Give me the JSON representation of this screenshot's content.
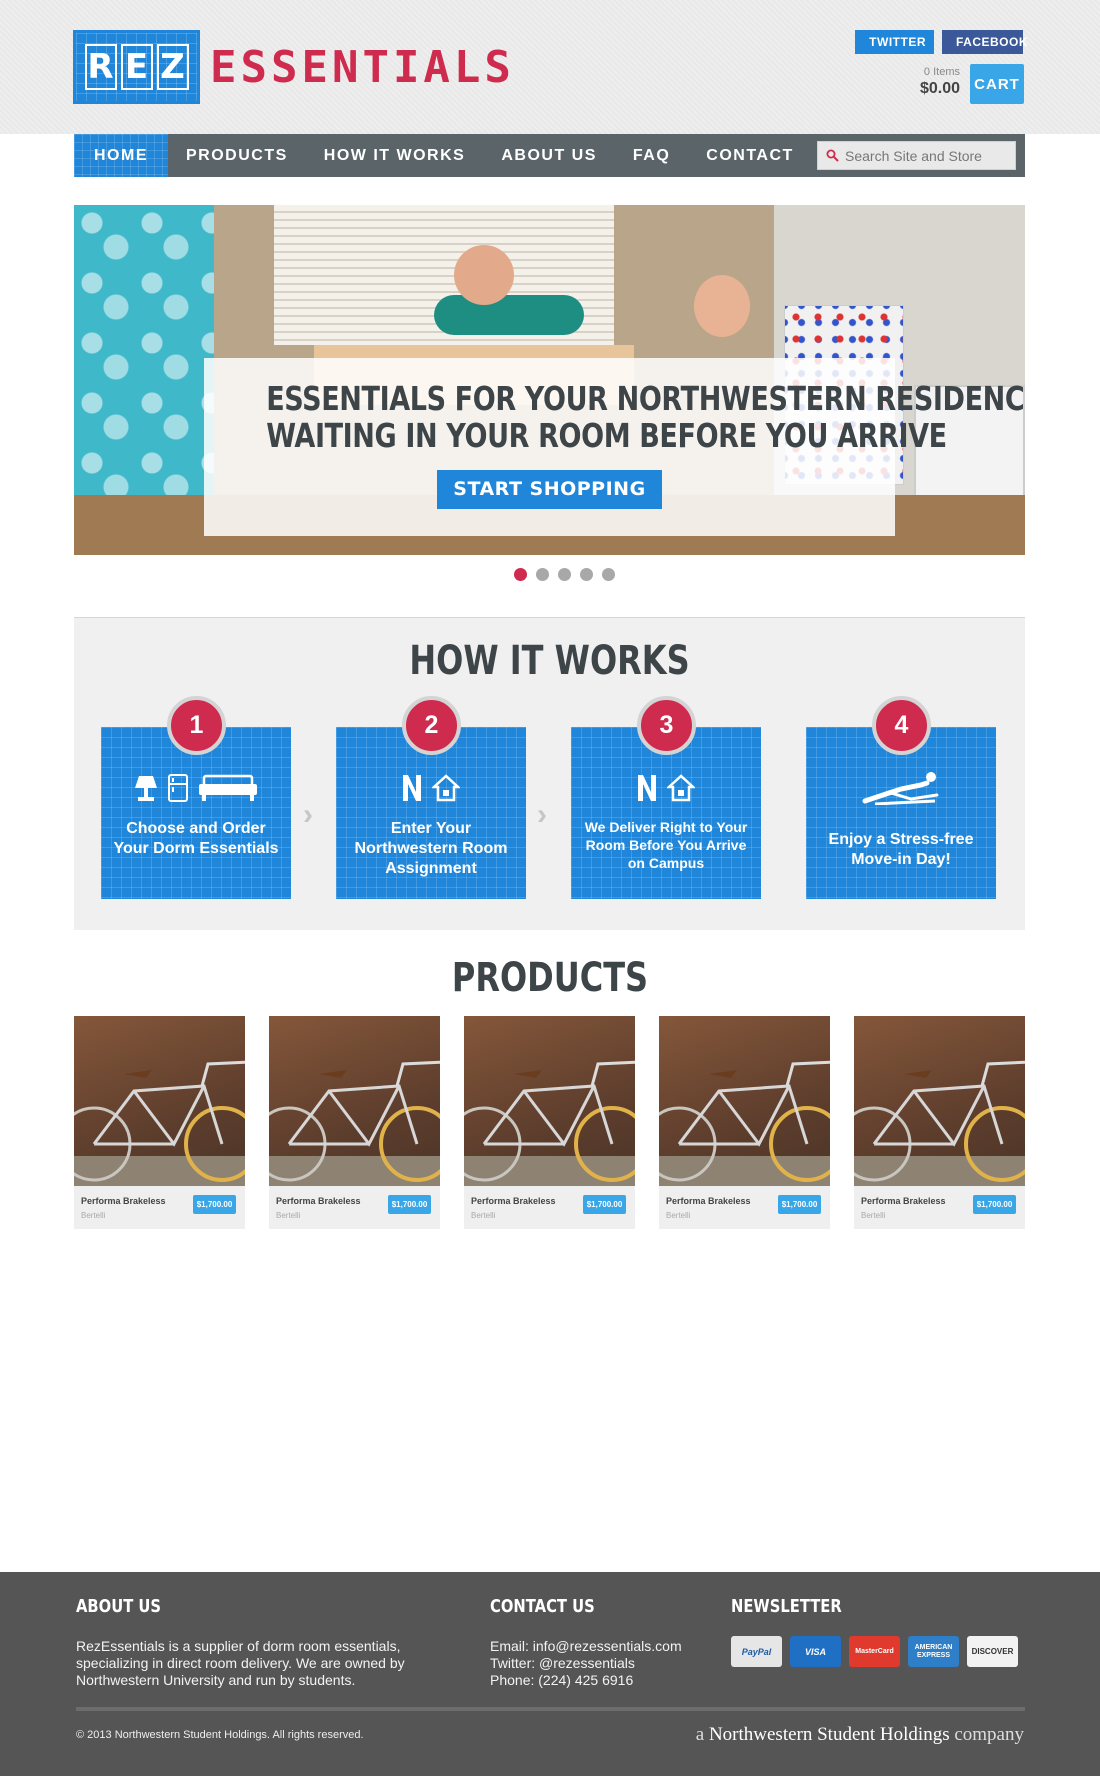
{
  "header": {
    "logo_letters": [
      "R",
      "E",
      "Z"
    ],
    "logo_word": "ESSENTIALS",
    "twitter_label": "TWITTER",
    "facebook_label": "FACEBOOK",
    "cart_items": "0 Items",
    "cart_total": "$0.00",
    "cart_label": "CART"
  },
  "nav": {
    "items": [
      {
        "label": "HOME",
        "active": true
      },
      {
        "label": "PRODUCTS"
      },
      {
        "label": "HOW IT WORKS"
      },
      {
        "label": "ABOUT US"
      },
      {
        "label": "FAQ"
      },
      {
        "label": "CONTACT"
      }
    ],
    "search_placeholder": "Search Site and Store"
  },
  "hero": {
    "title_line1": "ESSENTIALS FOR YOUR NORTHWESTERN RESIDENCE,",
    "title_line2": "WAITING IN YOUR ROOM BEFORE YOU ARRIVE",
    "button_label": "START SHOPPING",
    "slides": 5,
    "active_slide": 1
  },
  "how_it_works": {
    "title": "HOW IT WORKS",
    "steps": [
      {
        "number": "1",
        "text": "Choose and Order Your Dorm Essentials",
        "icons": [
          "lamp-icon",
          "fridge-icon",
          "couch-icon"
        ]
      },
      {
        "number": "2",
        "text": "Enter Your Northwestern Room Assignment",
        "icons": [
          "northwestern-n-icon",
          "house-icon"
        ]
      },
      {
        "number": "3",
        "text": "We Deliver Right to Your Room Before You Arrive on Campus",
        "icons": [
          "northwestern-n-icon",
          "house-icon"
        ]
      },
      {
        "number": "4",
        "text": "Enjoy a Stress-free Move-in Day!",
        "icons": [
          "relaxing-person-icon"
        ]
      }
    ]
  },
  "products": {
    "title": "PRODUCTS",
    "items": [
      {
        "name": "Performa Brakeless",
        "brand": "Bertelli",
        "price": "$1,700.00"
      },
      {
        "name": "Performa Brakeless",
        "brand": "Bertelli",
        "price": "$1,700.00"
      },
      {
        "name": "Performa Brakeless",
        "brand": "Bertelli",
        "price": "$1,700.00"
      },
      {
        "name": "Performa Brakeless",
        "brand": "Bertelli",
        "price": "$1,700.00"
      },
      {
        "name": "Performa Brakeless",
        "brand": "Bertelli",
        "price": "$1,700.00"
      }
    ]
  },
  "footer": {
    "about_title": "ABOUT US",
    "about_text": "RezEssentials is a supplier of dorm room essentials, specializing in direct room delivery. We are owned by Northwestern University and run by students.",
    "contact_title": "CONTACT US",
    "contact_email": "Email: info@rezessentials.com",
    "contact_twitter": "Twitter: @rezessentials",
    "contact_phone": "Phone: (224) 425 6916",
    "newsletter_title": "NEWSLETTER",
    "payment_methods": [
      "PayPal",
      "VISA",
      "MasterCard",
      "AMERICAN EXPRESS",
      "DISCOVER"
    ],
    "copyright": "© 2013 Northwestern Student Holdings. All rights reserved.",
    "company_prefix": "a",
    "company_name": "Northwestern Student Holdings",
    "company_suffix": "company"
  },
  "colors": {
    "brand_blue": "#1f86d9",
    "brand_red": "#cf2b4e",
    "nav_gray": "#5b6469",
    "footer_gray": "#555555"
  }
}
